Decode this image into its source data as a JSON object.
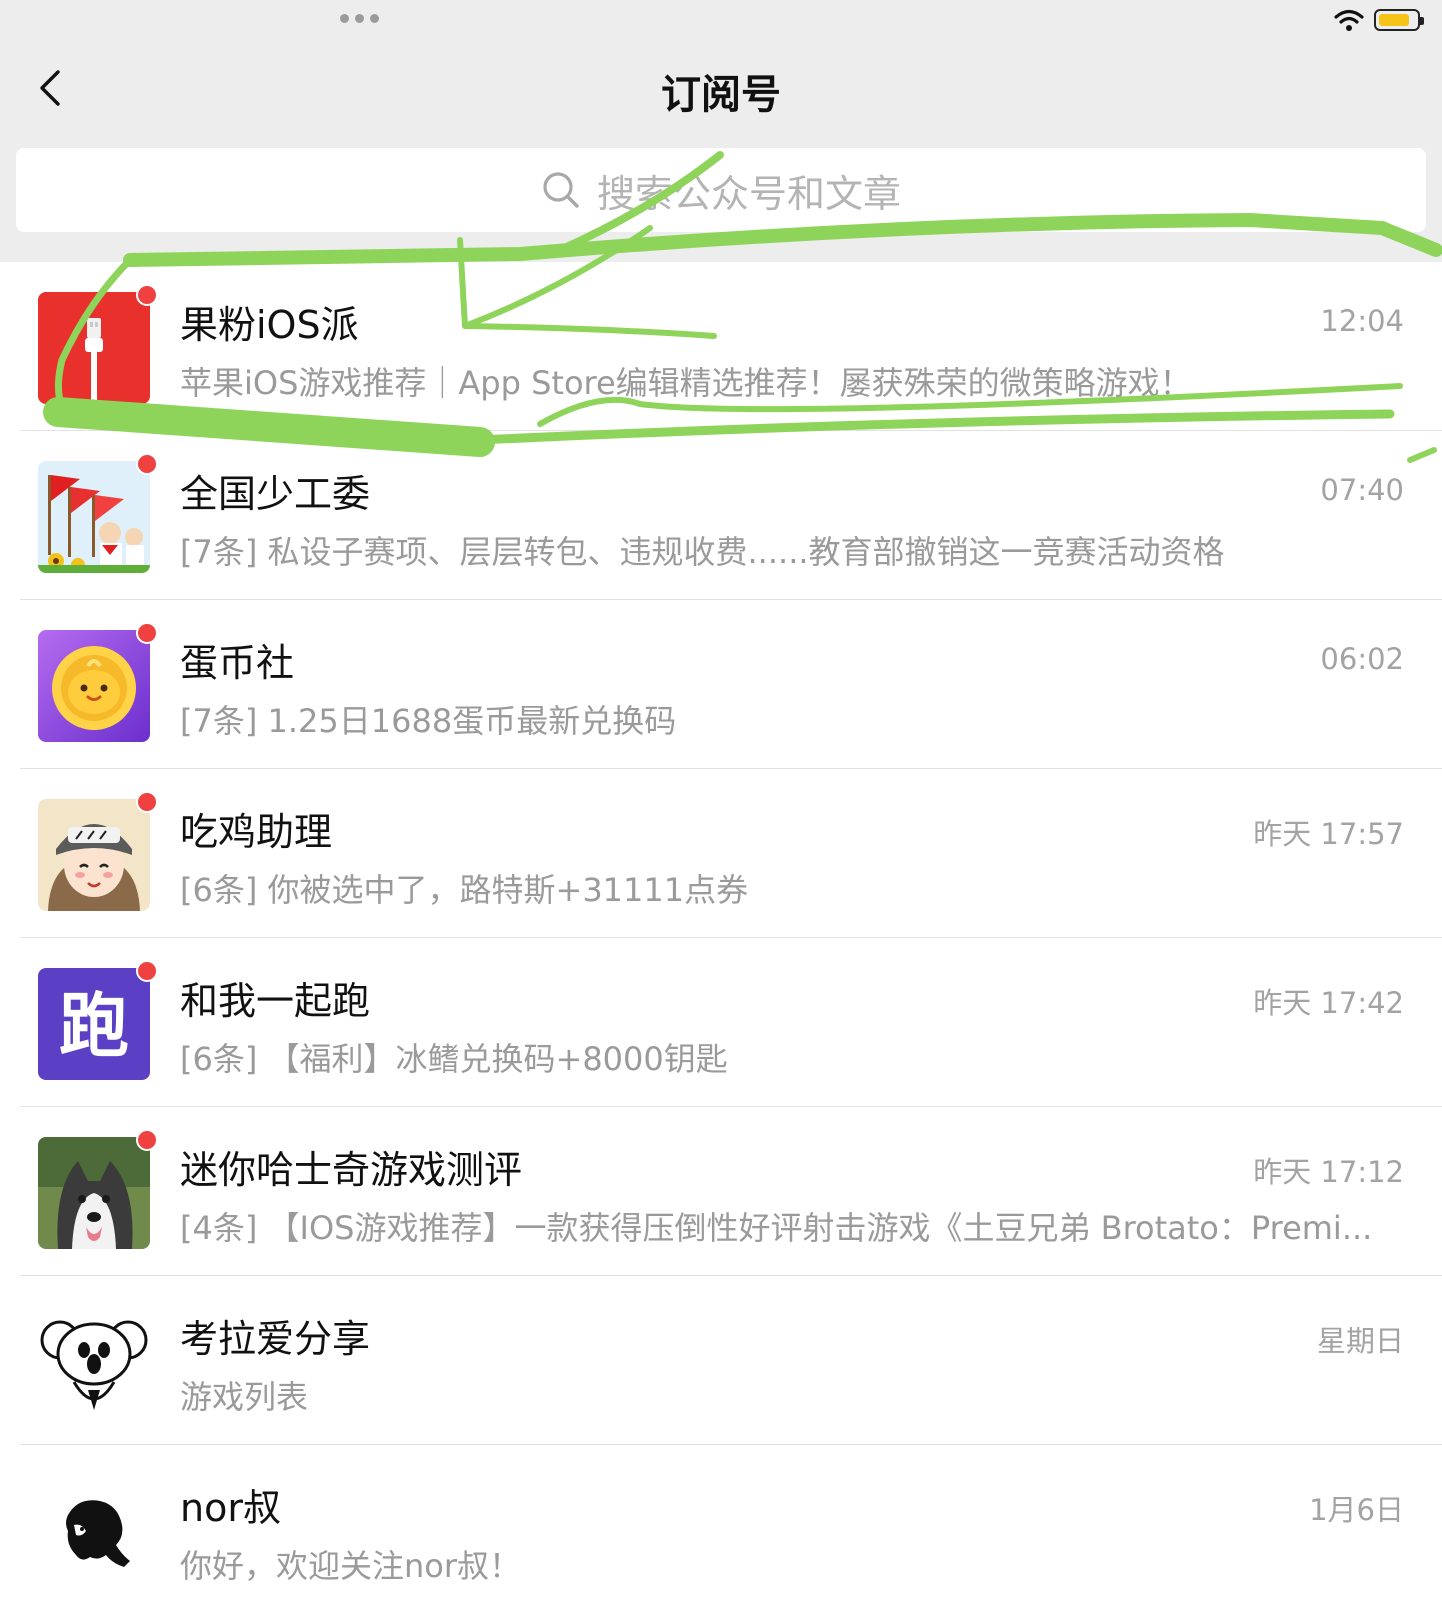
{
  "header": {
    "title": "订阅号",
    "search_placeholder": "搜索公众号和文章"
  },
  "colors": {
    "header_bg": "#ededed",
    "badge": "#f04141",
    "battery": "#f6c318",
    "scribble": "#8fd45a"
  },
  "items": [
    {
      "name": "果粉iOS派",
      "time": "12:04",
      "preview": "苹果iOS游戏推荐｜App Store编辑精选推荐！屡获殊荣的微策略游戏！",
      "unread": true,
      "avatar": "apple-cable-icon"
    },
    {
      "name": "全国少工委",
      "time": "07:40",
      "preview": "[7条] 私设子赛项、层层转包、违规收费......教育部撤销这一竞赛活动资格",
      "unread": true,
      "avatar": "young-pioneers-avatar"
    },
    {
      "name": "蛋币社",
      "time": "06:02",
      "preview": "[7条] 1.25日1688蛋币最新兑换码",
      "unread": true,
      "avatar": "egg-coin-avatar"
    },
    {
      "name": "吃鸡助理",
      "time": "昨天 17:57",
      "preview": "[6条] 你被选中了，路特斯+31111点券",
      "unread": true,
      "avatar": "helmet-girl-avatar"
    },
    {
      "name": "和我一起跑",
      "time": "昨天 17:42",
      "preview": "[6条] 【福利】冰鳍兑换码+8000钥匙",
      "unread": true,
      "avatar": "run-logo-avatar",
      "avatar_text": "跑"
    },
    {
      "name": "迷你哈士奇游戏测评",
      "time": "昨天 17:12",
      "preview": "[4条] 【IOS游戏推荐】一款获得压倒性好评射击游戏《土豆兄弟 Brotato：Premi...",
      "unread": true,
      "avatar": "husky-avatar"
    },
    {
      "name": "考拉爱分享",
      "time": "星期日",
      "preview": "游戏列表",
      "unread": false,
      "avatar": "koala-avatar"
    },
    {
      "name": "nor叔",
      "time": "1月6日",
      "preview": "你好，欢迎关注nor叔！",
      "unread": false,
      "avatar": "silhouette-avatar"
    }
  ]
}
